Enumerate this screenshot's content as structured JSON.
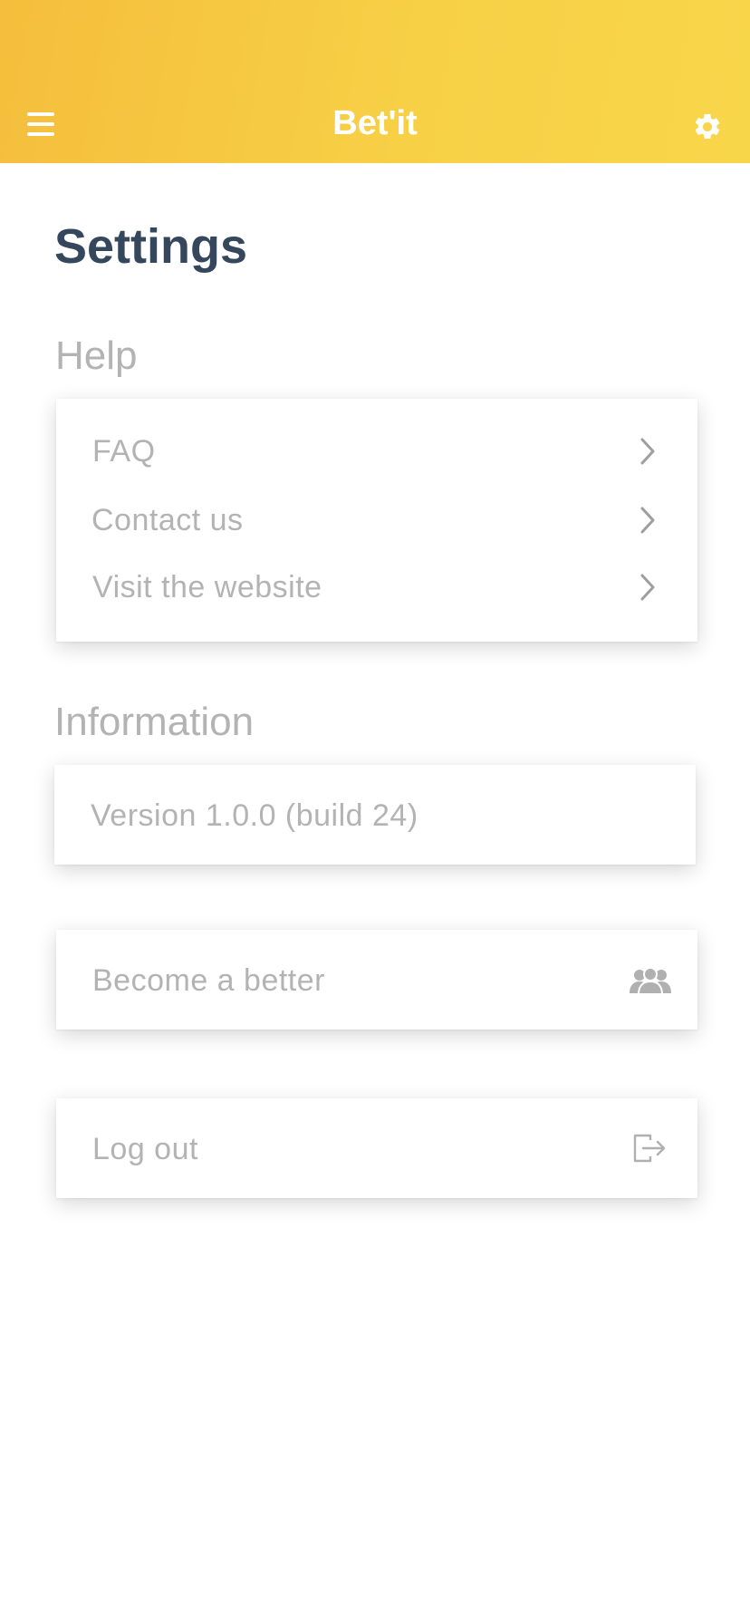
{
  "header": {
    "title": "Bet'it",
    "menu_icon": "hamburger-menu-icon",
    "settings_icon": "gear-icon"
  },
  "page": {
    "title": "Settings"
  },
  "help": {
    "title": "Help",
    "items": [
      {
        "label": "FAQ"
      },
      {
        "label": "Contact us"
      },
      {
        "label": "Visit the website"
      }
    ]
  },
  "information": {
    "title": "Information",
    "version": "Version 1.0.0 (build 24)"
  },
  "better": {
    "label": "Become a better",
    "icon": "group-icon"
  },
  "logout": {
    "label": "Log out",
    "icon": "logout-icon"
  },
  "colors": {
    "header_start": "#f5be3c",
    "header_end": "#f8d64a",
    "title": "#34475c",
    "muted_text": "#b3b3b3"
  }
}
